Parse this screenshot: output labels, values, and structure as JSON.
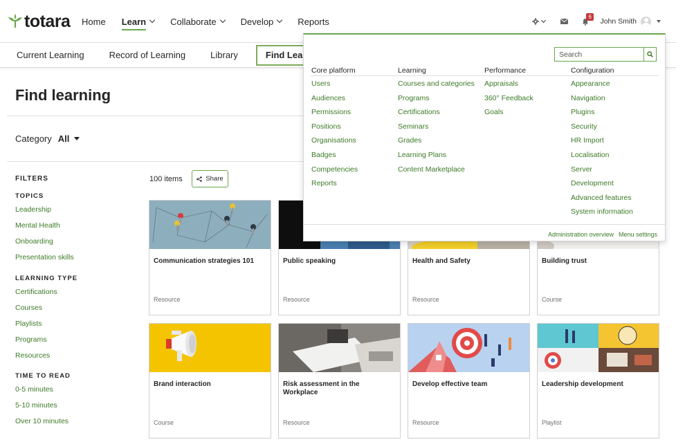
{
  "brand": {
    "name": "totara",
    "accent": "#69a74c",
    "link": "#3c7a27"
  },
  "mainnav": {
    "home": "Home",
    "learn": "Learn",
    "collaborate": "Collaborate",
    "develop": "Develop",
    "reports": "Reports"
  },
  "user": {
    "name": "John Smith",
    "notification_count": "6"
  },
  "subnav": {
    "current": "Current Learning",
    "record": "Record of Learning",
    "library": "Library",
    "find": "Find Learning"
  },
  "page": {
    "title": "Find learning",
    "category_label": "Category",
    "category_value": "All",
    "items_count": "100 items",
    "share_label": "Share"
  },
  "filters": {
    "heading": "FILTERS",
    "topics_heading": "TOPICS",
    "topics": [
      "Leadership",
      "Mental Health",
      "Onboarding",
      "Presentation skills"
    ],
    "type_heading": "LEARNING TYPE",
    "types": [
      "Certifications",
      "Courses",
      "Playlists",
      "Programs",
      "Resources"
    ],
    "time_heading": "TIME TO READ",
    "times": [
      "0-5 minutes",
      "5-10 minutes",
      "Over 10 minutes"
    ]
  },
  "cards": [
    {
      "title": "Communication strategies 101",
      "type": "Resource"
    },
    {
      "title": "Public speaking",
      "type": "Resource"
    },
    {
      "title": "Health and Safety",
      "type": "Resource"
    },
    {
      "title": "Building trust",
      "type": "Course"
    },
    {
      "title": "Brand interaction",
      "type": "Course"
    },
    {
      "title": "Risk assessment in the Workplace",
      "type": "Resource"
    },
    {
      "title": "Develop effective team",
      "type": "Resource"
    },
    {
      "title": "Leadership development",
      "type": "Playlist"
    }
  ],
  "admin_menu": {
    "search_placeholder": "Search",
    "columns": [
      {
        "heading": "Core platform",
        "items": [
          "Users",
          "Audiences",
          "Permissions",
          "Positions",
          "Organisations",
          "Badges",
          "Competencies",
          "Reports"
        ]
      },
      {
        "heading": "Learning",
        "items": [
          "Courses and categories",
          "Programs",
          "Certifications",
          "Seminars",
          "Grades",
          "Learning Plans",
          "Content Marketplace"
        ]
      },
      {
        "heading": "Performance",
        "items": [
          "Appraisals",
          "360° Feedback",
          "Goals"
        ]
      },
      {
        "heading": "Configuration",
        "items": [
          "Appearance",
          "Navigation",
          "Plugins",
          "Security",
          "HR Import",
          "Localisation",
          "Server",
          "Development",
          "Advanced features",
          "System information"
        ]
      }
    ],
    "footer_overview": "Administration overview",
    "footer_settings": "Menu settings"
  }
}
